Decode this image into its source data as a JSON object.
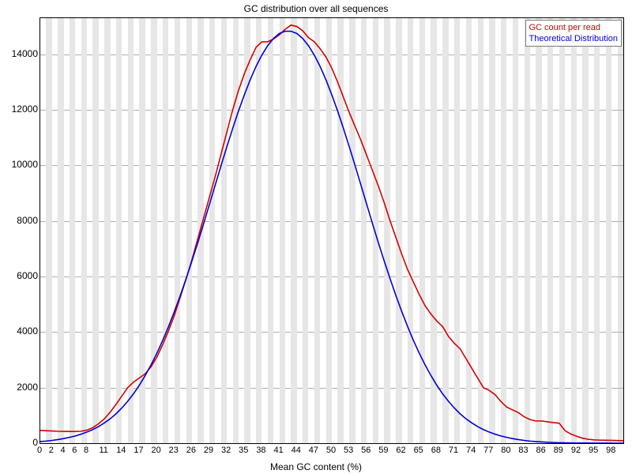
{
  "chart_data": {
    "type": "line",
    "title": "GC distribution over all sequences",
    "xlabel": "Mean GC content (%)",
    "ylabel": "",
    "xlim": [
      0,
      100
    ],
    "ylim": [
      0,
      15300
    ],
    "y_ticks": [
      0,
      2000,
      4000,
      6000,
      8000,
      10000,
      12000,
      14000
    ],
    "x_ticks": [
      0,
      2,
      4,
      6,
      8,
      11,
      14,
      17,
      20,
      23,
      26,
      29,
      32,
      35,
      38,
      41,
      44,
      47,
      50,
      53,
      56,
      59,
      62,
      65,
      68,
      71,
      74,
      77,
      80,
      83,
      86,
      89,
      92,
      95,
      98
    ],
    "x": [
      0,
      1,
      2,
      3,
      4,
      5,
      6,
      7,
      8,
      9,
      10,
      11,
      12,
      13,
      14,
      15,
      16,
      17,
      18,
      19,
      20,
      21,
      22,
      23,
      24,
      25,
      26,
      27,
      28,
      29,
      30,
      31,
      32,
      33,
      34,
      35,
      36,
      37,
      38,
      39,
      40,
      41,
      42,
      43,
      44,
      45,
      46,
      47,
      48,
      49,
      50,
      51,
      52,
      53,
      54,
      55,
      56,
      57,
      58,
      59,
      60,
      61,
      62,
      63,
      64,
      65,
      66,
      67,
      68,
      69,
      70,
      71,
      72,
      73,
      74,
      75,
      76,
      77,
      78,
      79,
      80,
      81,
      82,
      83,
      84,
      85,
      86,
      87,
      88,
      89,
      90,
      91,
      92,
      93,
      94,
      95,
      96,
      97,
      98,
      99,
      100
    ],
    "series": [
      {
        "name": "GC count per read",
        "color": "#d60000",
        "values": [
          460,
          450,
          440,
          430,
          425,
          420,
          420,
          430,
          470,
          560,
          700,
          880,
          1120,
          1400,
          1700,
          2000,
          2200,
          2350,
          2500,
          2750,
          3100,
          3550,
          4050,
          4600,
          5250,
          5900,
          6600,
          7350,
          8100,
          8850,
          9600,
          10400,
          11200,
          12000,
          12700,
          13300,
          13800,
          14250,
          14450,
          14450,
          14550,
          14700,
          14900,
          15050,
          15000,
          14850,
          14600,
          14450,
          14200,
          13900,
          13500,
          13000,
          12450,
          11900,
          11400,
          10900,
          10350,
          9800,
          9250,
          8650,
          8000,
          7400,
          6800,
          6250,
          5800,
          5350,
          4950,
          4650,
          4400,
          4200,
          3850,
          3600,
          3400,
          3050,
          2700,
          2350,
          2000,
          1900,
          1750,
          1500,
          1300,
          1200,
          1100,
          950,
          850,
          800,
          800,
          770,
          740,
          720,
          450,
          330,
          250,
          180,
          140,
          120,
          110,
          105,
          100,
          95,
          90
        ]
      },
      {
        "name": "Theoretical Distribution",
        "color": "#0000d6",
        "values": [
          60,
          75,
          100,
          130,
          165,
          210,
          260,
          325,
          400,
          490,
          600,
          730,
          880,
          1060,
          1270,
          1510,
          1780,
          2090,
          2440,
          2820,
          3240,
          3700,
          4200,
          4740,
          5310,
          5920,
          6550,
          7210,
          7890,
          8590,
          9290,
          9990,
          10670,
          11330,
          11960,
          12540,
          13080,
          13560,
          13970,
          14310,
          14570,
          14750,
          14830,
          14830,
          14750,
          14570,
          14310,
          13970,
          13560,
          13080,
          12540,
          11960,
          11330,
          10670,
          9990,
          9290,
          8590,
          7890,
          7210,
          6550,
          5920,
          5310,
          4740,
          4200,
          3700,
          3240,
          2820,
          2440,
          2090,
          1780,
          1510,
          1270,
          1060,
          880,
          730,
          600,
          490,
          400,
          325,
          260,
          210,
          165,
          130,
          100,
          75,
          60,
          45,
          34,
          25,
          18,
          13,
          10,
          7,
          5,
          4,
          3,
          2,
          1,
          1,
          0,
          0
        ]
      }
    ],
    "legend": {
      "position": "top-right",
      "items": [
        {
          "label": "GC count per read",
          "color": "#d60000"
        },
        {
          "label": "Theoretical Distribution",
          "color": "#0000d6"
        }
      ]
    }
  }
}
